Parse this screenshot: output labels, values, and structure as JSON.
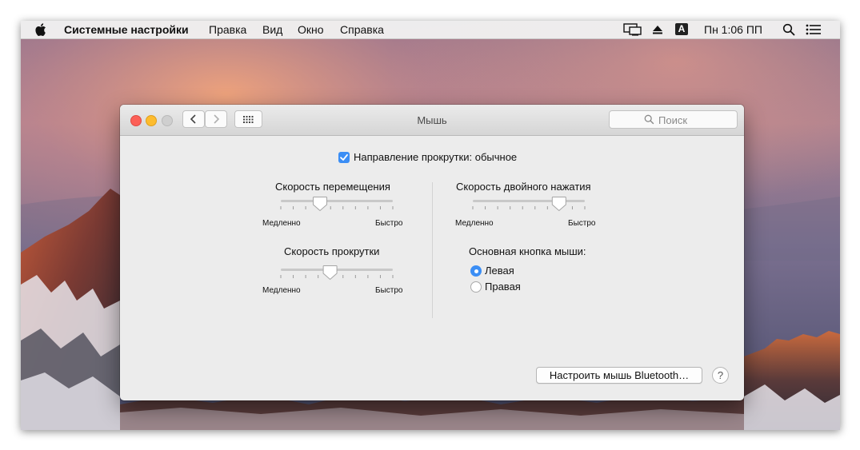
{
  "menubar": {
    "app_name": "Системные настройки",
    "items": [
      "Правка",
      "Вид",
      "Окно",
      "Справка"
    ],
    "input_indicator": "A",
    "clock": "Пн 1:06 ПП"
  },
  "window": {
    "title": "Мышь",
    "search_placeholder": "Поиск",
    "scroll_direction_label": "Направление прокрутки: обычное",
    "scroll_direction_checked": true,
    "tracking_speed": {
      "label": "Скорость перемещения",
      "min_label": "Медленно",
      "max_label": "Быстро",
      "level": 0.35
    },
    "scroll_speed": {
      "label": "Скорость прокрутки",
      "min_label": "Медленно",
      "max_label": "Быстро",
      "level": 0.44
    },
    "double_click_speed": {
      "label": "Скорость двойного нажатия",
      "min_label": "Медленно",
      "max_label": "Быстро",
      "level": 0.77
    },
    "primary_button": {
      "label": "Основная кнопка мыши:",
      "options": [
        "Левая",
        "Правая"
      ],
      "selected": "Левая"
    },
    "bluetooth_button": "Настроить мышь Bluetooth…",
    "help_label": "?"
  },
  "colors": {
    "accent": "#3b8ef5",
    "close": "#fc5f57",
    "minimize": "#fdbc2e",
    "zoom_inactive": "#cfcfcf"
  }
}
